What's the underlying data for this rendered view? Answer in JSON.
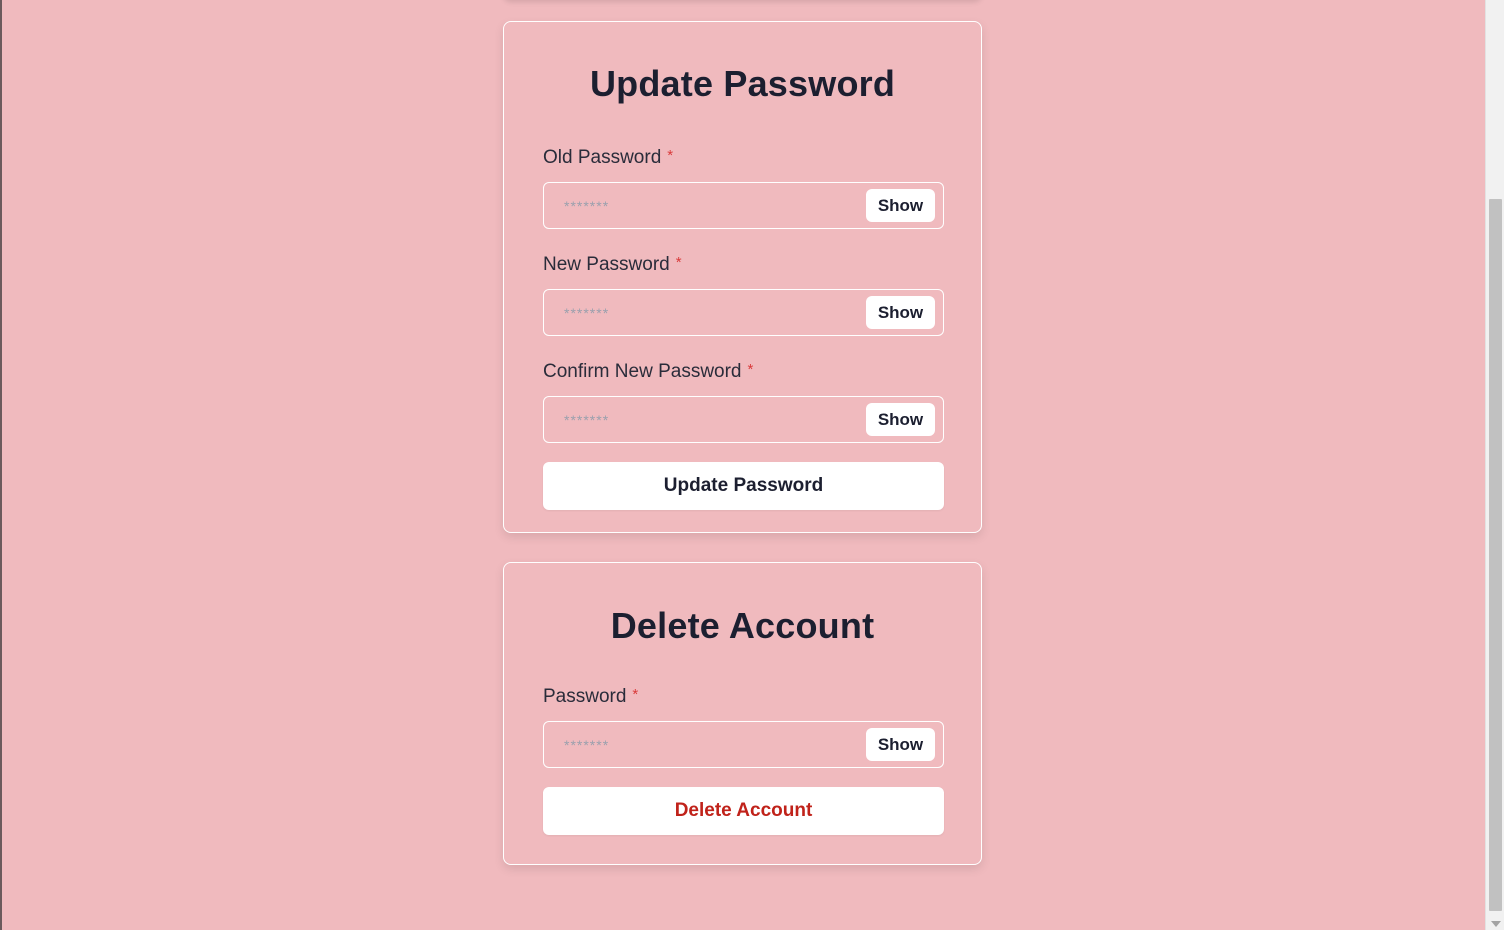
{
  "update_password": {
    "title": "Update Password",
    "fields": [
      {
        "label": "Old Password",
        "required_mark": "*",
        "placeholder": "*******",
        "toggle_label": "Show"
      },
      {
        "label": "New Password",
        "required_mark": "*",
        "placeholder": "*******",
        "toggle_label": "Show"
      },
      {
        "label": "Confirm New Password",
        "required_mark": "*",
        "placeholder": "*******",
        "toggle_label": "Show"
      }
    ],
    "submit_label": "Update Password"
  },
  "delete_account": {
    "title": "Delete Account",
    "fields": [
      {
        "label": "Password",
        "required_mark": "*",
        "placeholder": "*******",
        "toggle_label": "Show"
      }
    ],
    "submit_label": "Delete Account"
  },
  "colors": {
    "page_background": "#f0babe",
    "heading": "#1c1f30",
    "required_mark": "#d93a3a",
    "danger_text": "#c0221a",
    "button_background": "#ffffff"
  }
}
